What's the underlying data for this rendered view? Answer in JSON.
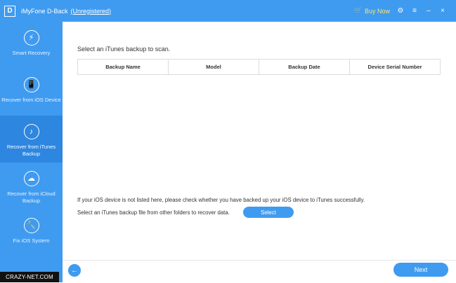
{
  "app": {
    "logo_text": "D",
    "title": "iMyFone D-Back",
    "registration": "(Unregistered)"
  },
  "titlebar": {
    "buy_now": "Buy Now",
    "icons": [
      "cart-icon",
      "gear-icon",
      "menu-icon",
      "minimize-icon",
      "close-icon"
    ],
    "icon_glyphs": {
      "cart": "🛒",
      "gear": "⚙",
      "menu": "≡",
      "minimize": "–",
      "close": "×"
    },
    "colors": {
      "bar": "#3f9bf0",
      "buy_now": "#ffe26a"
    }
  },
  "sidebar": {
    "items": [
      {
        "label": "Smart Recovery",
        "icon": "lightning-icon",
        "glyph": "⚡",
        "active": false
      },
      {
        "label": "Recover from iOS Device",
        "icon": "phone-icon",
        "glyph": "📱",
        "active": false
      },
      {
        "label": "Recover from iTunes Backup",
        "icon": "music-note-icon",
        "glyph": "♪",
        "active": true
      },
      {
        "label": "Recover from iCloud Backup",
        "icon": "cloud-download-icon",
        "glyph": "☁",
        "active": false
      },
      {
        "label": "Fix iOS System",
        "icon": "wrench-icon",
        "glyph": "🔧",
        "active": false
      }
    ]
  },
  "content": {
    "instruction": "Select an iTunes backup to scan.",
    "table_headers": [
      "Backup Name",
      "Model",
      "Backup Date",
      "Device Serial Number"
    ],
    "note_not_listed": "If your iOS device is not listed here, please check whether you have backed up your iOS device to iTunes successfully.",
    "note_other_folder": "Select an iTunes backup file from other folders to recover data.",
    "select_button": "Select"
  },
  "footer": {
    "back_icon": "←",
    "next_button": "Next"
  },
  "watermark": "CRAZY-NET.COM"
}
